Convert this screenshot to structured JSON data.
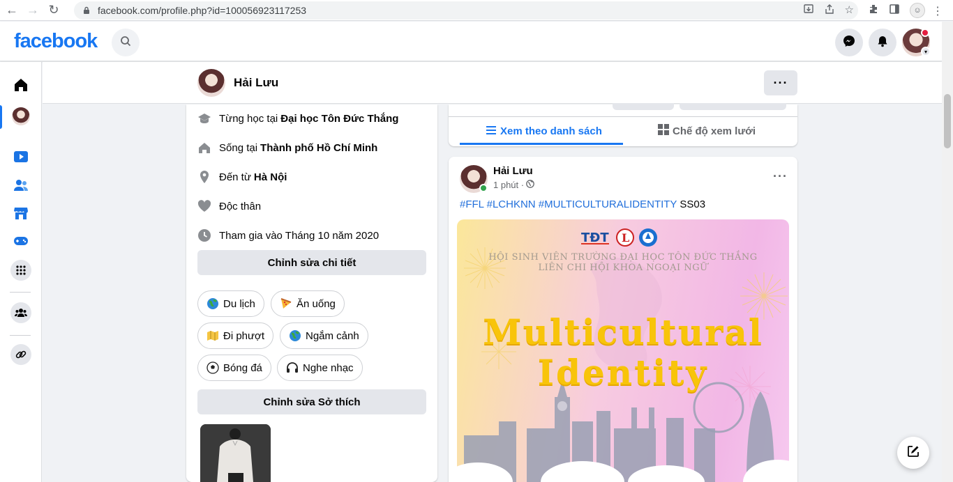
{
  "browser": {
    "url": "facebook.com/profile.php?id=100056923117253"
  },
  "topbar": {
    "logo": "facebook"
  },
  "profile_header": {
    "name": "Hải Lưu",
    "more": "···"
  },
  "intro": {
    "studied_prefix": "Từng học tại",
    "studied_value": "Đại học Tôn Đức Thắng",
    "lives_prefix": "Sống tại",
    "lives_value": "Thành phố Hồ Chí Minh",
    "from_prefix": "Đến từ",
    "from_value": "Hà Nội",
    "relationship": "Độc thân",
    "joined": "Tham gia vào Tháng 10 năm 2020",
    "edit_details": "Chỉnh sửa chi tiết",
    "hobbies": [
      "Du lịch",
      "Ăn uống",
      "Đi phượt",
      "Ngắm cảnh",
      "Bóng đá",
      "Nghe nhạc"
    ],
    "edit_hobbies": "Chỉnh sửa Sở thích"
  },
  "view_tabs": {
    "list": "Xem theo danh sách",
    "grid": "Chế độ xem lưới"
  },
  "post": {
    "author": "Hải Lưu",
    "time": "1 phút ·",
    "hashtags": "#FFL #LCHKNN #MULTICULTURALIDENTITY",
    "suffix": "SS03",
    "image": {
      "line1": "HỘI SINH VIÊN TRƯỜNG ĐẠI HỌC TÔN ĐỨC THẮNG",
      "line2": "LIÊN CHI HỘI KHOA NGOẠI NGỮ",
      "title1": "Multicultural",
      "title2": "Identity"
    }
  },
  "colors": {
    "fb_blue": "#1877f2",
    "online": "#31a24c",
    "notification": "#e41e3f"
  }
}
